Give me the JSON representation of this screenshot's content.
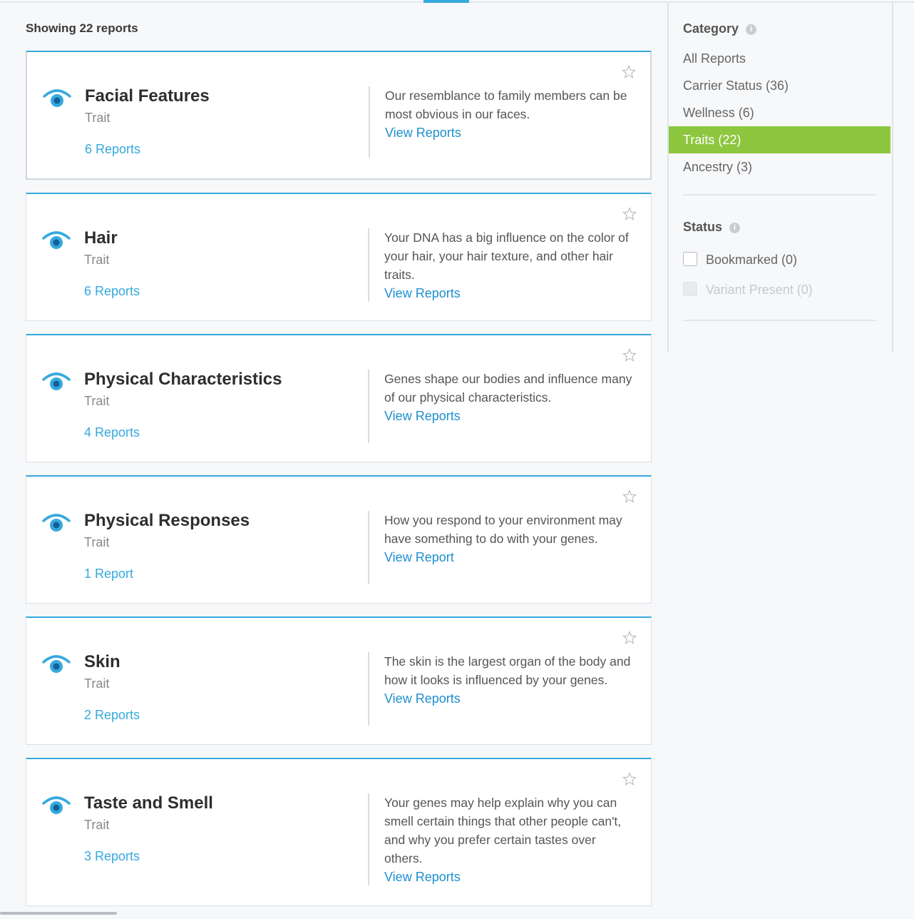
{
  "header": {
    "showing": "Showing 22 reports"
  },
  "colors": {
    "accent": "#35a9dd",
    "selected": "#8dc63f",
    "link": "#1e8fcf"
  },
  "cards": [
    {
      "title": "Facial Features",
      "type": "Trait",
      "count": "6 Reports",
      "desc": "Our resemblance to family members can be most obvious in our faces.",
      "view": "View Reports",
      "icon": "eye-icon"
    },
    {
      "title": "Hair",
      "type": "Trait",
      "count": "6 Reports",
      "desc": "Your DNA has a big influence on the color of your hair, your hair texture, and other hair traits.",
      "view": "View Reports",
      "icon": "eye-icon"
    },
    {
      "title": "Physical Characteristics",
      "type": "Trait",
      "count": "4 Reports",
      "desc": "Genes shape our bodies and influence many of our physical characteristics.",
      "view": "View Reports",
      "icon": "eye-icon"
    },
    {
      "title": "Physical Responses",
      "type": "Trait",
      "count": "1 Report",
      "desc": "How you respond to your environment may have something to do with your genes.",
      "view": "View Report",
      "icon": "eye-icon"
    },
    {
      "title": "Skin",
      "type": "Trait",
      "count": "2 Reports",
      "desc": "The skin is the largest organ of the body and how it looks is influenced by your genes.",
      "view": "View Reports",
      "icon": "eye-icon"
    },
    {
      "title": "Taste and Smell",
      "type": "Trait",
      "count": "3 Reports",
      "desc": "Your genes may help explain why you can smell certain things that other people can't, and why you prefer certain tastes over others.",
      "view": "View Reports",
      "icon": "eye-icon"
    }
  ],
  "sidebar": {
    "category_title": "Category",
    "categories": [
      {
        "label": "All Reports",
        "selected": false
      },
      {
        "label": "Carrier Status (36)",
        "selected": false
      },
      {
        "label": "Wellness (6)",
        "selected": false
      },
      {
        "label": "Traits (22)",
        "selected": true
      },
      {
        "label": "Ancestry (3)",
        "selected": false
      }
    ],
    "status_title": "Status",
    "statuses": [
      {
        "label": "Bookmarked (0)",
        "disabled": false,
        "checked": false
      },
      {
        "label": "Variant Present (0)",
        "disabled": true,
        "checked": false
      }
    ]
  }
}
